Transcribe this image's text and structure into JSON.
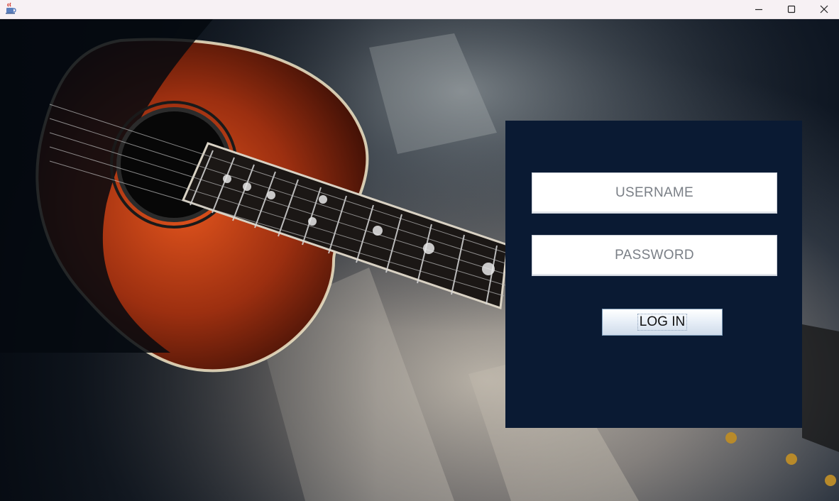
{
  "window": {
    "title": "",
    "icon": "java-cup-icon",
    "controls": [
      "minimize-icon",
      "maximize-icon",
      "close-icon"
    ]
  },
  "background": {
    "subject": "acoustic-guitar"
  },
  "login": {
    "username_placeholder": "USERNAME",
    "password_placeholder": "PASSWORD",
    "login_label": "LOG IN"
  },
  "colors": {
    "panel": "#0a1a33",
    "titlebar": "#f7f1f4",
    "guitar_body": "#b5411a",
    "field_text": "#7a7f86"
  }
}
